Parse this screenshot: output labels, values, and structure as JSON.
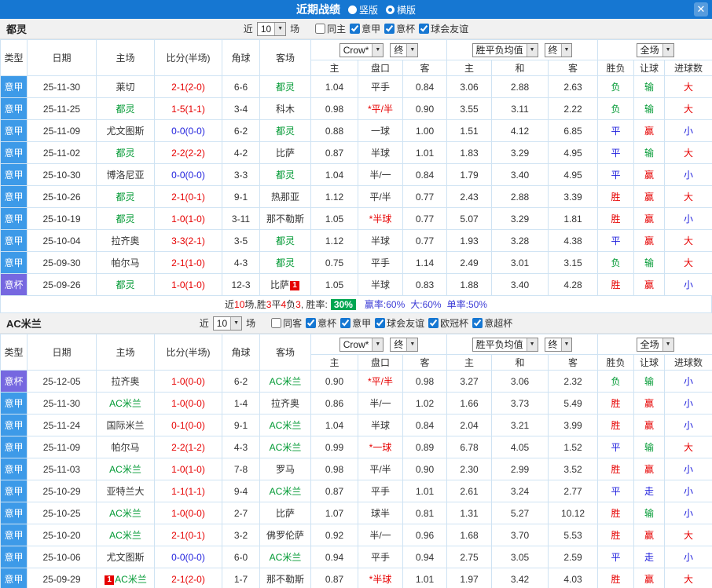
{
  "colors": {
    "titlebar_blue": "#1677d2",
    "league_blue": "#3d9ae8",
    "cup_purple": "#7668e0",
    "focus_team_green": "#009933",
    "score_red": "#e60000",
    "score_draw_blue": "#2222dd",
    "win_red": "#e60000",
    "draw_blue": "#2222dd",
    "loss_green": "#009933",
    "rate_badge_green": "#00a651",
    "summary_blue": "#3b3bd6",
    "table_border": "#cfe3f3"
  },
  "titlebar": {
    "title": "近期战绩",
    "radios": [
      {
        "label": "竖版",
        "selected": false
      },
      {
        "label": "横版",
        "selected": true
      }
    ],
    "close_icon": "✕"
  },
  "sections": [
    {
      "team": "都灵",
      "filter": {
        "near_label": "近",
        "count_value": "10",
        "unit_label": "场",
        "venue": {
          "label": "同主",
          "checked": false
        },
        "leagues": [
          {
            "label": "意甲",
            "checked": true
          },
          {
            "label": "意杯",
            "checked": true
          },
          {
            "label": "球会友谊",
            "checked": true
          }
        ]
      },
      "table": {
        "col_headers": [
          "类型",
          "日期",
          "主场",
          "比分(半场)",
          "角球",
          "客场"
        ],
        "sub_headers": [
          "主",
          "盘口",
          "客",
          "主",
          "和",
          "客",
          "胜负",
          "让球",
          "进球数"
        ],
        "dropdowns": {
          "odds_source": "Crow*",
          "odds_final": "终",
          "avg": "胜平负均值",
          "avg_final": "终",
          "scope": "全场"
        },
        "rows": [
          {
            "type": "意甲",
            "type_style": "blue",
            "date": "25-11-30",
            "home": "莱切",
            "home_focus": false,
            "home_badge": "",
            "score": "2-1(2-0)",
            "score_style": "red",
            "corners": "6-6",
            "away": "都灵",
            "away_focus": true,
            "away_badge": "",
            "odds_home": "1.04",
            "handicap": "平手",
            "handicap_red": false,
            "odds_away": "0.84",
            "avg_home": "3.06",
            "avg_draw": "2.88",
            "avg_away": "2.63",
            "result": "负",
            "result_style": "green",
            "let_result": "输",
            "let_style": "green",
            "goals": "大",
            "goals_style": "red"
          },
          {
            "type": "意甲",
            "type_style": "blue",
            "date": "25-11-25",
            "home": "都灵",
            "home_focus": true,
            "home_badge": "",
            "score": "1-5(1-1)",
            "score_style": "red",
            "corners": "3-4",
            "away": "科木",
            "away_focus": false,
            "away_badge": "",
            "odds_home": "0.98",
            "handicap": "*平/半",
            "handicap_red": true,
            "odds_away": "0.90",
            "avg_home": "3.55",
            "avg_draw": "3.11",
            "avg_away": "2.22",
            "result": "负",
            "result_style": "green",
            "let_result": "输",
            "let_style": "green",
            "goals": "大",
            "goals_style": "red"
          },
          {
            "type": "意甲",
            "type_style": "blue",
            "date": "25-11-09",
            "home": "尤文图斯",
            "home_focus": false,
            "home_badge": "",
            "score": "0-0(0-0)",
            "score_style": "blue",
            "corners": "6-2",
            "away": "都灵",
            "away_focus": true,
            "away_badge": "",
            "odds_home": "0.88",
            "handicap": "一球",
            "handicap_red": false,
            "odds_away": "1.00",
            "avg_home": "1.51",
            "avg_draw": "4.12",
            "avg_away": "6.85",
            "result": "平",
            "result_style": "blue",
            "let_result": "赢",
            "let_style": "red",
            "goals": "小",
            "goals_style": "blue"
          },
          {
            "type": "意甲",
            "type_style": "blue",
            "date": "25-11-02",
            "home": "都灵",
            "home_focus": true,
            "home_badge": "",
            "score": "2-2(2-2)",
            "score_style": "red",
            "corners": "4-2",
            "away": "比萨",
            "away_focus": false,
            "away_badge": "",
            "odds_home": "0.87",
            "handicap": "半球",
            "handicap_red": false,
            "odds_away": "1.01",
            "avg_home": "1.83",
            "avg_draw": "3.29",
            "avg_away": "4.95",
            "result": "平",
            "result_style": "blue",
            "let_result": "输",
            "let_style": "green",
            "goals": "大",
            "goals_style": "red"
          },
          {
            "type": "意甲",
            "type_style": "blue",
            "date": "25-10-30",
            "home": "博洛尼亚",
            "home_focus": false,
            "home_badge": "",
            "score": "0-0(0-0)",
            "score_style": "blue",
            "corners": "3-3",
            "away": "都灵",
            "away_focus": true,
            "away_badge": "",
            "odds_home": "1.04",
            "handicap": "半/一",
            "handicap_red": false,
            "odds_away": "0.84",
            "avg_home": "1.79",
            "avg_draw": "3.40",
            "avg_away": "4.95",
            "result": "平",
            "result_style": "blue",
            "let_result": "赢",
            "let_style": "red",
            "goals": "小",
            "goals_style": "blue"
          },
          {
            "type": "意甲",
            "type_style": "blue",
            "date": "25-10-26",
            "home": "都灵",
            "home_focus": true,
            "home_badge": "",
            "score": "2-1(0-1)",
            "score_style": "red",
            "corners": "9-1",
            "away": "热那亚",
            "away_focus": false,
            "away_badge": "",
            "odds_home": "1.12",
            "handicap": "平/半",
            "handicap_red": false,
            "odds_away": "0.77",
            "avg_home": "2.43",
            "avg_draw": "2.88",
            "avg_away": "3.39",
            "result": "胜",
            "result_style": "red",
            "let_result": "赢",
            "let_style": "red",
            "goals": "大",
            "goals_style": "red"
          },
          {
            "type": "意甲",
            "type_style": "blue",
            "date": "25-10-19",
            "home": "都灵",
            "home_focus": true,
            "home_badge": "",
            "score": "1-0(1-0)",
            "score_style": "red",
            "corners": "3-11",
            "away": "那不勒斯",
            "away_focus": false,
            "away_badge": "",
            "odds_home": "1.05",
            "handicap": "*半球",
            "handicap_red": true,
            "odds_away": "0.77",
            "avg_home": "5.07",
            "avg_draw": "3.29",
            "avg_away": "1.81",
            "result": "胜",
            "result_style": "red",
            "let_result": "赢",
            "let_style": "red",
            "goals": "小",
            "goals_style": "blue"
          },
          {
            "type": "意甲",
            "type_style": "blue",
            "date": "25-10-04",
            "home": "拉齐奥",
            "home_focus": false,
            "home_badge": "",
            "score": "3-3(2-1)",
            "score_style": "red",
            "corners": "3-5",
            "away": "都灵",
            "away_focus": true,
            "away_badge": "",
            "odds_home": "1.12",
            "handicap": "半球",
            "handicap_red": false,
            "odds_away": "0.77",
            "avg_home": "1.93",
            "avg_draw": "3.28",
            "avg_away": "4.38",
            "result": "平",
            "result_style": "blue",
            "let_result": "赢",
            "let_style": "red",
            "goals": "大",
            "goals_style": "red"
          },
          {
            "type": "意甲",
            "type_style": "blue",
            "date": "25-09-30",
            "home": "帕尔马",
            "home_focus": false,
            "home_badge": "",
            "score": "2-1(1-0)",
            "score_style": "red",
            "corners": "4-3",
            "away": "都灵",
            "away_focus": true,
            "away_badge": "",
            "odds_home": "0.75",
            "handicap": "平手",
            "handicap_red": false,
            "odds_away": "1.14",
            "avg_home": "2.49",
            "avg_draw": "3.01",
            "avg_away": "3.15",
            "result": "负",
            "result_style": "green",
            "let_result": "输",
            "let_style": "green",
            "goals": "大",
            "goals_style": "red"
          },
          {
            "type": "意杯",
            "type_style": "purple",
            "date": "25-09-26",
            "home": "都灵",
            "home_focus": true,
            "home_badge": "",
            "score": "1-0(1-0)",
            "score_style": "red",
            "corners": "12-3",
            "away": "比萨",
            "away_focus": false,
            "away_badge": "1",
            "odds_home": "1.05",
            "handicap": "半球",
            "handicap_red": false,
            "odds_away": "0.83",
            "avg_home": "1.88",
            "avg_draw": "3.40",
            "avg_away": "4.28",
            "result": "胜",
            "result_style": "red",
            "let_result": "赢",
            "let_style": "red",
            "goals": "小",
            "goals_style": "blue"
          }
        ]
      },
      "summary": [
        {
          "t": "近",
          "s": "dark"
        },
        {
          "t": "10",
          "s": "red"
        },
        {
          "t": "场,胜",
          "s": "dark"
        },
        {
          "t": "3",
          "s": "red"
        },
        {
          "t": "平",
          "s": "dark"
        },
        {
          "t": "4",
          "s": "red"
        },
        {
          "t": "负",
          "s": "dark"
        },
        {
          "t": "3",
          "s": "red"
        },
        {
          "t": ", 胜率:",
          "s": "dark"
        },
        {
          "t": "30%",
          "s": "greenbox"
        },
        {
          "t": "赢率:60%",
          "s": "blue"
        },
        {
          "t": "大:60%",
          "s": "blue"
        },
        {
          "t": "单率:50%",
          "s": "blue"
        }
      ]
    },
    {
      "team": "AC米兰",
      "filter": {
        "near_label": "近",
        "count_value": "10",
        "unit_label": "场",
        "venue": {
          "label": "同客",
          "checked": false
        },
        "leagues": [
          {
            "label": "意杯",
            "checked": true
          },
          {
            "label": "意甲",
            "checked": true
          },
          {
            "label": "球会友谊",
            "checked": true
          },
          {
            "label": "欧冠杯",
            "checked": true
          },
          {
            "label": "意超杯",
            "checked": true
          }
        ]
      },
      "table": {
        "col_headers": [
          "类型",
          "日期",
          "主场",
          "比分(半场)",
          "角球",
          "客场"
        ],
        "sub_headers": [
          "主",
          "盘口",
          "客",
          "主",
          "和",
          "客",
          "胜负",
          "让球",
          "进球数"
        ],
        "dropdowns": {
          "odds_source": "Crow*",
          "odds_final": "终",
          "avg": "胜平负均值",
          "avg_final": "终",
          "scope": "全场"
        },
        "rows": [
          {
            "type": "意杯",
            "type_style": "purple",
            "date": "25-12-05",
            "home": "拉齐奥",
            "home_focus": false,
            "home_badge": "",
            "score": "1-0(0-0)",
            "score_style": "red",
            "corners": "6-2",
            "away": "AC米兰",
            "away_focus": true,
            "away_badge": "",
            "odds_home": "0.90",
            "handicap": "*平/半",
            "handicap_red": true,
            "odds_away": "0.98",
            "avg_home": "3.27",
            "avg_draw": "3.06",
            "avg_away": "2.32",
            "result": "负",
            "result_style": "green",
            "let_result": "输",
            "let_style": "green",
            "goals": "小",
            "goals_style": "blue"
          },
          {
            "type": "意甲",
            "type_style": "blue",
            "date": "25-11-30",
            "home": "AC米兰",
            "home_focus": true,
            "home_badge": "",
            "score": "1-0(0-0)",
            "score_style": "red",
            "corners": "1-4",
            "away": "拉齐奥",
            "away_focus": false,
            "away_badge": "",
            "odds_home": "0.86",
            "handicap": "半/一",
            "handicap_red": false,
            "odds_away": "1.02",
            "avg_home": "1.66",
            "avg_draw": "3.73",
            "avg_away": "5.49",
            "result": "胜",
            "result_style": "red",
            "let_result": "赢",
            "let_style": "red",
            "goals": "小",
            "goals_style": "blue"
          },
          {
            "type": "意甲",
            "type_style": "blue",
            "date": "25-11-24",
            "home": "国际米兰",
            "home_focus": false,
            "home_badge": "",
            "score": "0-1(0-0)",
            "score_style": "red",
            "corners": "9-1",
            "away": "AC米兰",
            "away_focus": true,
            "away_badge": "",
            "odds_home": "1.04",
            "handicap": "半球",
            "handicap_red": false,
            "odds_away": "0.84",
            "avg_home": "2.04",
            "avg_draw": "3.21",
            "avg_away": "3.99",
            "result": "胜",
            "result_style": "red",
            "let_result": "赢",
            "let_style": "red",
            "goals": "小",
            "goals_style": "blue"
          },
          {
            "type": "意甲",
            "type_style": "blue",
            "date": "25-11-09",
            "home": "帕尔马",
            "home_focus": false,
            "home_badge": "",
            "score": "2-2(1-2)",
            "score_style": "red",
            "corners": "4-3",
            "away": "AC米兰",
            "away_focus": true,
            "away_badge": "",
            "odds_home": "0.99",
            "handicap": "*一球",
            "handicap_red": true,
            "odds_away": "0.89",
            "avg_home": "6.78",
            "avg_draw": "4.05",
            "avg_away": "1.52",
            "result": "平",
            "result_style": "blue",
            "let_result": "输",
            "let_style": "green",
            "goals": "大",
            "goals_style": "red"
          },
          {
            "type": "意甲",
            "type_style": "blue",
            "date": "25-11-03",
            "home": "AC米兰",
            "home_focus": true,
            "home_badge": "",
            "score": "1-0(1-0)",
            "score_style": "red",
            "corners": "7-8",
            "away": "罗马",
            "away_focus": false,
            "away_badge": "",
            "odds_home": "0.98",
            "handicap": "平/半",
            "handicap_red": false,
            "odds_away": "0.90",
            "avg_home": "2.30",
            "avg_draw": "2.99",
            "avg_away": "3.52",
            "result": "胜",
            "result_style": "red",
            "let_result": "赢",
            "let_style": "red",
            "goals": "小",
            "goals_style": "blue"
          },
          {
            "type": "意甲",
            "type_style": "blue",
            "date": "25-10-29",
            "home": "亚特兰大",
            "home_focus": false,
            "home_badge": "",
            "score": "1-1(1-1)",
            "score_style": "red",
            "corners": "9-4",
            "away": "AC米兰",
            "away_focus": true,
            "away_badge": "",
            "odds_home": "0.87",
            "handicap": "平手",
            "handicap_red": false,
            "odds_away": "1.01",
            "avg_home": "2.61",
            "avg_draw": "3.24",
            "avg_away": "2.77",
            "result": "平",
            "result_style": "blue",
            "let_result": "走",
            "let_style": "blue",
            "goals": "小",
            "goals_style": "blue"
          },
          {
            "type": "意甲",
            "type_style": "blue",
            "date": "25-10-25",
            "home": "AC米兰",
            "home_focus": true,
            "home_badge": "",
            "score": "1-0(0-0)",
            "score_style": "red",
            "corners": "2-7",
            "away": "比萨",
            "away_focus": false,
            "away_badge": "",
            "odds_home": "1.07",
            "handicap": "球半",
            "handicap_red": false,
            "odds_away": "0.81",
            "avg_home": "1.31",
            "avg_draw": "5.27",
            "avg_away": "10.12",
            "result": "胜",
            "result_style": "red",
            "let_result": "输",
            "let_style": "green",
            "goals": "小",
            "goals_style": "blue"
          },
          {
            "type": "意甲",
            "type_style": "blue",
            "date": "25-10-20",
            "home": "AC米兰",
            "home_focus": true,
            "home_badge": "",
            "score": "2-1(0-1)",
            "score_style": "red",
            "corners": "3-2",
            "away": "佛罗伦萨",
            "away_focus": false,
            "away_badge": "",
            "odds_home": "0.92",
            "handicap": "半/一",
            "handicap_red": false,
            "odds_away": "0.96",
            "avg_home": "1.68",
            "avg_draw": "3.70",
            "avg_away": "5.53",
            "result": "胜",
            "result_style": "red",
            "let_result": "赢",
            "let_style": "red",
            "goals": "大",
            "goals_style": "red"
          },
          {
            "type": "意甲",
            "type_style": "blue",
            "date": "25-10-06",
            "home": "尤文图斯",
            "home_focus": false,
            "home_badge": "",
            "score": "0-0(0-0)",
            "score_style": "blue",
            "corners": "6-0",
            "away": "AC米兰",
            "away_focus": true,
            "away_badge": "",
            "odds_home": "0.94",
            "handicap": "平手",
            "handicap_red": false,
            "odds_away": "0.94",
            "avg_home": "2.75",
            "avg_draw": "3.05",
            "avg_away": "2.59",
            "result": "平",
            "result_style": "blue",
            "let_result": "走",
            "let_style": "blue",
            "goals": "小",
            "goals_style": "blue"
          },
          {
            "type": "意甲",
            "type_style": "blue",
            "date": "25-09-29",
            "home": "AC米兰",
            "home_focus": true,
            "home_badge": "1",
            "score": "2-1(2-0)",
            "score_style": "red",
            "corners": "1-7",
            "away": "那不勒斯",
            "away_focus": false,
            "away_badge": "",
            "odds_home": "0.87",
            "handicap": "*半球",
            "handicap_red": true,
            "odds_away": "1.01",
            "avg_home": "1.97",
            "avg_draw": "3.42",
            "avg_away": "4.03",
            "result": "胜",
            "result_style": "red",
            "let_result": "赢",
            "let_style": "red",
            "goals": "大",
            "goals_style": "red"
          }
        ]
      },
      "summary": null
    }
  ]
}
